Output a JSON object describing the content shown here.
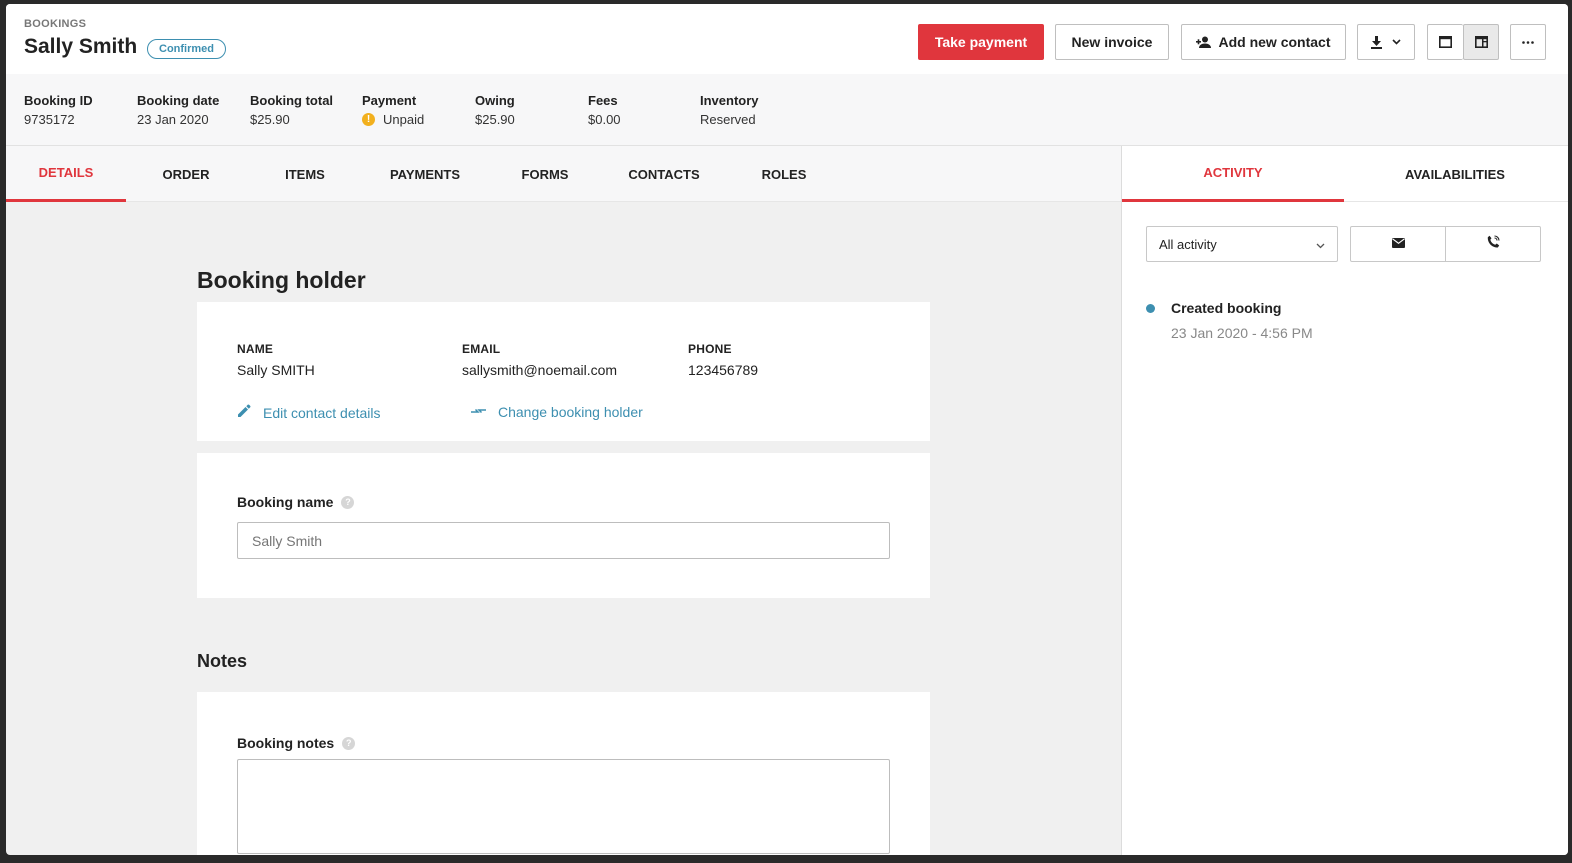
{
  "header": {
    "breadcrumb": "BOOKINGS",
    "title": "Sally Smith",
    "status_badge": "Confirmed",
    "buttons": {
      "take_payment": "Take payment",
      "new_invoice": "New invoice",
      "add_contact": "Add new contact"
    },
    "icons": [
      "download-icon",
      "chevron-down-icon",
      "single-pane-icon",
      "split-pane-icon",
      "more-icon",
      "add-person-icon"
    ]
  },
  "summary": [
    {
      "label": "Booking ID",
      "value": "9735172"
    },
    {
      "label": "Booking date",
      "value": "23 Jan 2020"
    },
    {
      "label": "Booking total",
      "value": "$25.90"
    },
    {
      "label": "Payment",
      "value": "Unpaid",
      "icon": "warning-icon"
    },
    {
      "label": "Owing",
      "value": "$25.90"
    },
    {
      "label": "Fees",
      "value": "$0.00"
    },
    {
      "label": "Inventory",
      "value": "Reserved"
    }
  ],
  "tabs": [
    "DETAILS",
    "ORDER",
    "ITEMS",
    "PAYMENTS",
    "FORMS",
    "CONTACTS",
    "ROLES"
  ],
  "active_tab": "DETAILS",
  "booking_holder": {
    "heading": "Booking holder",
    "name_label": "NAME",
    "name": "Sally SMITH",
    "email_label": "EMAIL",
    "email": "sallysmith@noemail.com",
    "phone_label": "PHONE",
    "phone": "123456789",
    "edit_link": "Edit contact details",
    "change_link": "Change booking holder"
  },
  "booking_name": {
    "label": "Booking name",
    "help": "?",
    "placeholder": "Sally Smith"
  },
  "notes": {
    "heading": "Notes",
    "label": "Booking notes",
    "help": "?",
    "value": ""
  },
  "right_panel": {
    "tabs": [
      "ACTIVITY",
      "AVAILABILITIES"
    ],
    "active_tab": "ACTIVITY",
    "filter": "All activity",
    "activity": [
      {
        "title": "Created booking",
        "time": "23 Jan 2020 - 4:56 PM"
      }
    ]
  },
  "colors": {
    "accent": "#e0363d",
    "link": "#3d8fb0",
    "warning": "#f2b01e"
  }
}
